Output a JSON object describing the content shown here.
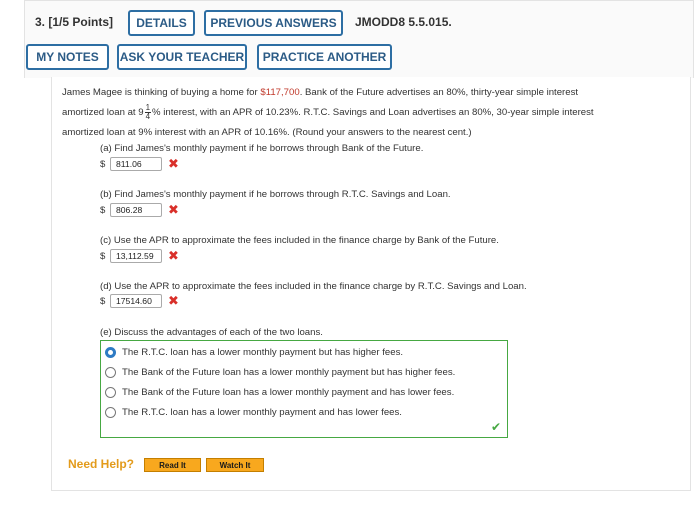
{
  "header": {
    "question_label": "3.  [1/5 Points]",
    "tabs": [
      "DETAILS",
      "PREVIOUS ANSWERS"
    ],
    "problem_code": "JMODD8 5.5.015.",
    "buttons": [
      "MY NOTES",
      "ASK YOUR TEACHER",
      "PRACTICE ANOTHER"
    ]
  },
  "problem": {
    "intro_1": "James Magee is thinking of buying a home for ",
    "price": "$117,700",
    "intro_2": ". Bank of the Future advertises an 80%, thirty-year simple interest",
    "intro_3": "amortized loan at 9",
    "frac_num": "1",
    "frac_den": "4",
    "intro_4": "% interest, with an APR of 10.23%. R.T.C. Savings and Loan advertises an 80%, 30-year simple interest",
    "intro_5": "amortized loan at 9% interest with an APR of 10.16%. (Round your answers to the nearest cent.)"
  },
  "parts": [
    {
      "question": "(a) Find James's monthly payment if he borrows through Bank of the Future.",
      "currency": "$",
      "answer": "811.06",
      "status": "incorrect"
    },
    {
      "question": "(b) Find James's monthly payment if he borrows through R.T.C. Savings and Loan.",
      "currency": "$",
      "answer": "806.28",
      "status": "incorrect"
    },
    {
      "question": "(c) Use the APR to approximate the fees included in the finance charge by Bank of the Future.",
      "currency": "$",
      "answer": "13,112.59",
      "status": "incorrect"
    },
    {
      "question": "(d) Use the APR to approximate the fees included in the finance charge by R.T.C. Savings and Loan.",
      "currency": "$",
      "answer": "17514.60",
      "status": "incorrect"
    }
  ],
  "part_e": {
    "question": "(e) Discuss the advantages of each of the two loans.",
    "options": [
      {
        "label": "The R.T.C. loan has a lower monthly payment but has higher fees.",
        "selected": true
      },
      {
        "label": "The Bank of the Future loan has a lower monthly payment but has higher fees.",
        "selected": false
      },
      {
        "label": "The Bank of the Future loan has a lower monthly payment and has lower fees.",
        "selected": false
      },
      {
        "label": "The R.T.C. loan has a lower monthly payment and has lower fees.",
        "selected": false
      }
    ],
    "status": "correct"
  },
  "help": {
    "label": "Need Help?",
    "buttons": [
      "Read It",
      "Watch It"
    ]
  },
  "icons": {
    "incorrect": "x-mark-icon",
    "correct": "check-mark-icon"
  },
  "colors": {
    "accent": "#2d6ea3",
    "incorrect": "#d9302a",
    "correct": "#46a842",
    "help": "#e39b1b"
  }
}
